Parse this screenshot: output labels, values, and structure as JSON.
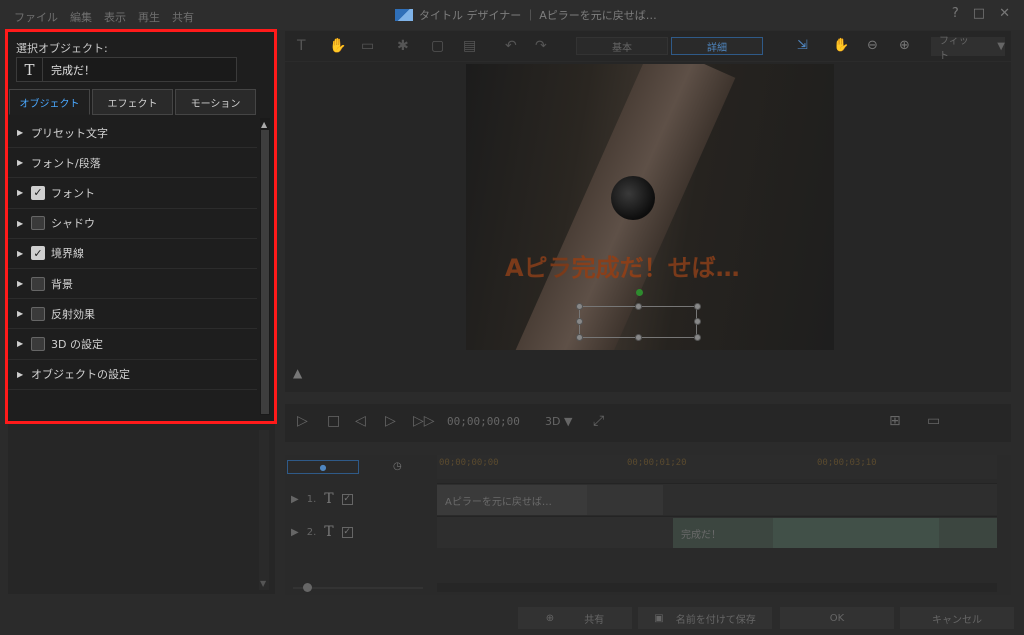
{
  "window": {
    "menu": [
      "ファイル",
      "編集",
      "表示",
      "再生",
      "共有"
    ],
    "title": "タイトル デザイナー ｜ Aピラーを元に戻せば…",
    "controls": [
      "?",
      "□",
      "✕"
    ]
  },
  "left_panel": {
    "selected_label": "選択オブジェクト:",
    "selected_icon": "T",
    "selected_name": "完成だ！",
    "tabs": [
      {
        "label": "オブジェクト",
        "active": true
      },
      {
        "label": "エフェクト",
        "active": false
      },
      {
        "label": "モーション",
        "active": false
      }
    ],
    "items": [
      {
        "label": "プリセット文字",
        "checkbox": null
      },
      {
        "label": "フォント/段落",
        "checkbox": null
      },
      {
        "label": "フォント",
        "checkbox": true
      },
      {
        "label": "シャドウ",
        "checkbox": false
      },
      {
        "label": "境界線",
        "checkbox": true
      },
      {
        "label": "背景",
        "checkbox": false
      },
      {
        "label": "反射効果",
        "checkbox": false
      },
      {
        "label": "3D の設定",
        "checkbox": false
      },
      {
        "label": "オブジェクトの設定",
        "checkbox": null
      }
    ]
  },
  "toolbar": {
    "mode_basic": "基本",
    "mode_detail": "詳細",
    "zoom_select": "フィット",
    "zoom_arrow": "▼"
  },
  "preview": {
    "overlay_text_a": "Aピラ",
    "overlay_text_sel": "完成だ！",
    "overlay_text_b": "せば…"
  },
  "player": {
    "timecode": "00;00;00;00",
    "mode_3d": "3D ▼"
  },
  "timeline": {
    "ruler": [
      "00;00;00;00",
      "00;00;01;20",
      "00;00;03;10"
    ],
    "tracks": [
      {
        "num": "1.",
        "clip": "Aピラーを元に戻せば…"
      },
      {
        "num": "2.",
        "clip": "完成だ！"
      }
    ]
  },
  "bottom": {
    "share": "共有",
    "save_as": "名前を付けて保存",
    "ok": "OK",
    "cancel": "キャンセル"
  },
  "colors": {
    "highlight_frame": "#ff1a1a",
    "accent_blue": "#4aa8ff"
  }
}
